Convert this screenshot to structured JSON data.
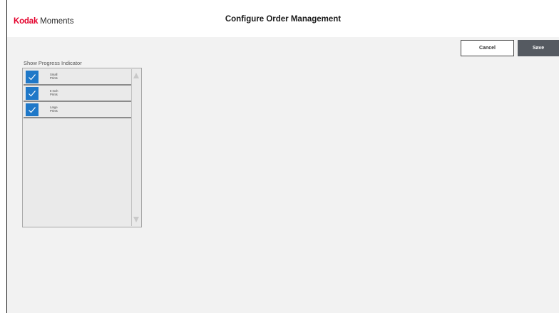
{
  "header": {
    "logo_brand": "Kodak",
    "logo_product": "Moments",
    "title": "Configure Order Management"
  },
  "toolbar": {
    "cancel_label": "Cancel",
    "save_label": "Save"
  },
  "progress_indicator": {
    "label": "Show Progress Indicator",
    "items": [
      {
        "line1": "Small",
        "line2": "Prints",
        "checked": true
      },
      {
        "line1": "8 Inch",
        "line2": "Prints",
        "checked": true
      },
      {
        "line1": "Large",
        "line2": "Prints",
        "checked": true
      }
    ]
  },
  "colors": {
    "brand_red": "#e4002b",
    "checkbox_blue": "#1f78c8",
    "save_button": "#555a61",
    "background": "#f2f2f2"
  },
  "icons": {
    "check": "checkmark-icon",
    "scroll_up": "triangle-up-icon",
    "scroll_down": "triangle-down-icon"
  }
}
